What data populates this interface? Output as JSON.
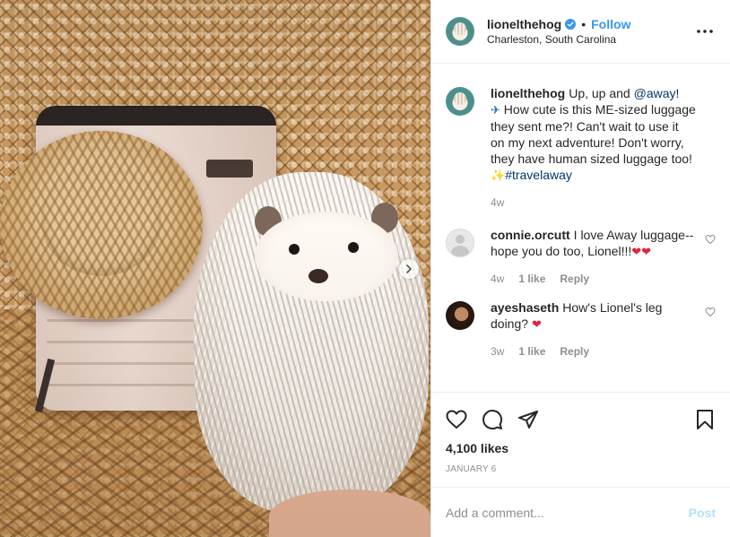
{
  "post": {
    "author": {
      "username": "lionelthehog",
      "verified": true,
      "separator": "•",
      "follow_label": "Follow",
      "location": "Charleston, South Carolina"
    },
    "caption": {
      "username": "lionelthehog",
      "text_1": "Up, up and ",
      "mention": "@away",
      "text_2": "! ",
      "plane_emoji": "✈",
      "text_3": " How cute is this ME-sized luggage they sent me?! Can't wait to use it on my next adventure! Don't worry, they have human sized luggage too!",
      "sparkle_emoji": "✨",
      "hashtag": "#travelaway",
      "age": "4w"
    },
    "comments": [
      {
        "username": "connie.orcutt",
        "text": "I love Away luggage--hope you do too, Lionel!!!",
        "hearts": "❤❤",
        "age": "4w",
        "likes": "1 like",
        "reply_label": "Reply"
      },
      {
        "username": "ayeshaseth",
        "text": "How's Lionel's leg doing?",
        "hearts": "❤",
        "age": "3w",
        "likes": "1 like",
        "reply_label": "Reply"
      }
    ],
    "likes_count": "4,100 likes",
    "date": "JANUARY 6",
    "add_comment_placeholder": "Add a comment...",
    "post_button": "Post"
  },
  "colors": {
    "link_blue": "#3897f0",
    "mention_navy": "#00376b",
    "muted_gray": "#8e8e8e",
    "post_disabled": "#b2dffc",
    "heart_red": "#e0243a"
  },
  "icons": {
    "verified": "verified-badge-icon",
    "more": "more-options-icon",
    "like": "heart-outline-icon",
    "comment": "speech-bubble-icon",
    "share": "paper-plane-icon",
    "save": "bookmark-icon",
    "carousel": "chevron-right-icon"
  }
}
